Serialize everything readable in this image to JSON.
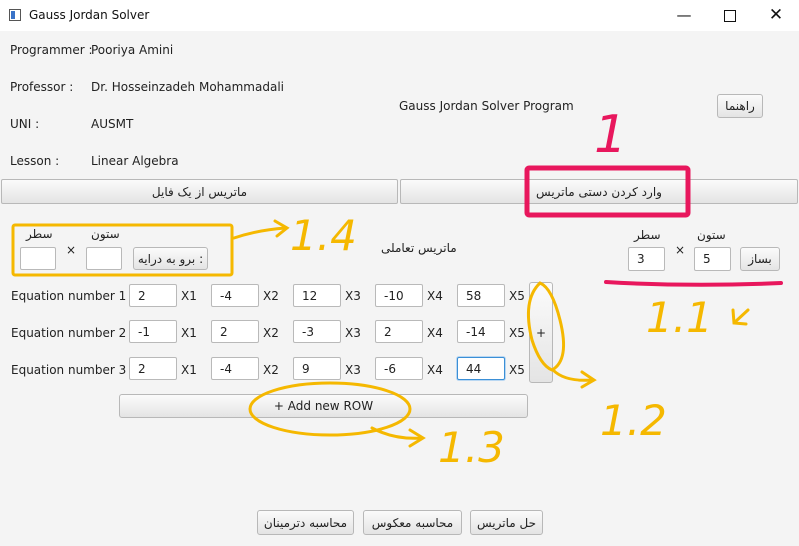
{
  "window": {
    "title": "Gauss Jordan Solver"
  },
  "info": {
    "programmer_label": "Programmer :",
    "programmer": "Pooriya Amini",
    "professor_label": "Professor :",
    "professor": "Dr. Hosseinzadeh Mohammadali",
    "uni_label": "UNI :",
    "uni": "AUSMT",
    "lesson_label": "Lesson :",
    "lesson": "Linear Algebra"
  },
  "program_title": "Gauss Jordan Solver Program",
  "help_button": "راهنما",
  "tabs": {
    "from_file": "ماتریس از یک فایل",
    "manual": "وارد کردن دستی ماتریس"
  },
  "file_section": {
    "rows_label": "سطر",
    "cols_label": "ستون",
    "times": "×",
    "go_button": "برو به درایه :",
    "rows_value": "",
    "cols_value": ""
  },
  "interactive_label": "ماتریس تعاملی",
  "build_section": {
    "rows_label": "سطر",
    "cols_label": "ستون",
    "times": "×",
    "rows_value": "3",
    "cols_value": "5",
    "build_button": "بساز"
  },
  "equations": [
    {
      "label": "Equation number 1 :",
      "values": [
        "2",
        "-4",
        "12",
        "-10",
        "58"
      ]
    },
    {
      "label": "Equation number 2 :",
      "values": [
        "-1",
        "2",
        "-3",
        "2",
        "-14"
      ]
    },
    {
      "label": "Equation number 3 :",
      "values": [
        "2",
        "-4",
        "9",
        "-6",
        "44"
      ]
    }
  ],
  "variables": [
    "X1",
    "X2",
    "X3",
    "X4",
    "X5"
  ],
  "add_column_button": "+",
  "add_row_button": "+ Add new ROW",
  "bottom_buttons": {
    "determinant": "محاسبه دترمینان",
    "inverse": "محاسبه معکوس",
    "solve": "حل ماتریس"
  },
  "annotations": {
    "a1": "1",
    "a11": "1.1",
    "a12": "1.2",
    "a13": "1.3",
    "a14": "1.4"
  },
  "colors": {
    "annotation_yellow": "#f5b800",
    "annotation_pink": "#e8175d",
    "focus_blue": "#3b8fd6"
  }
}
